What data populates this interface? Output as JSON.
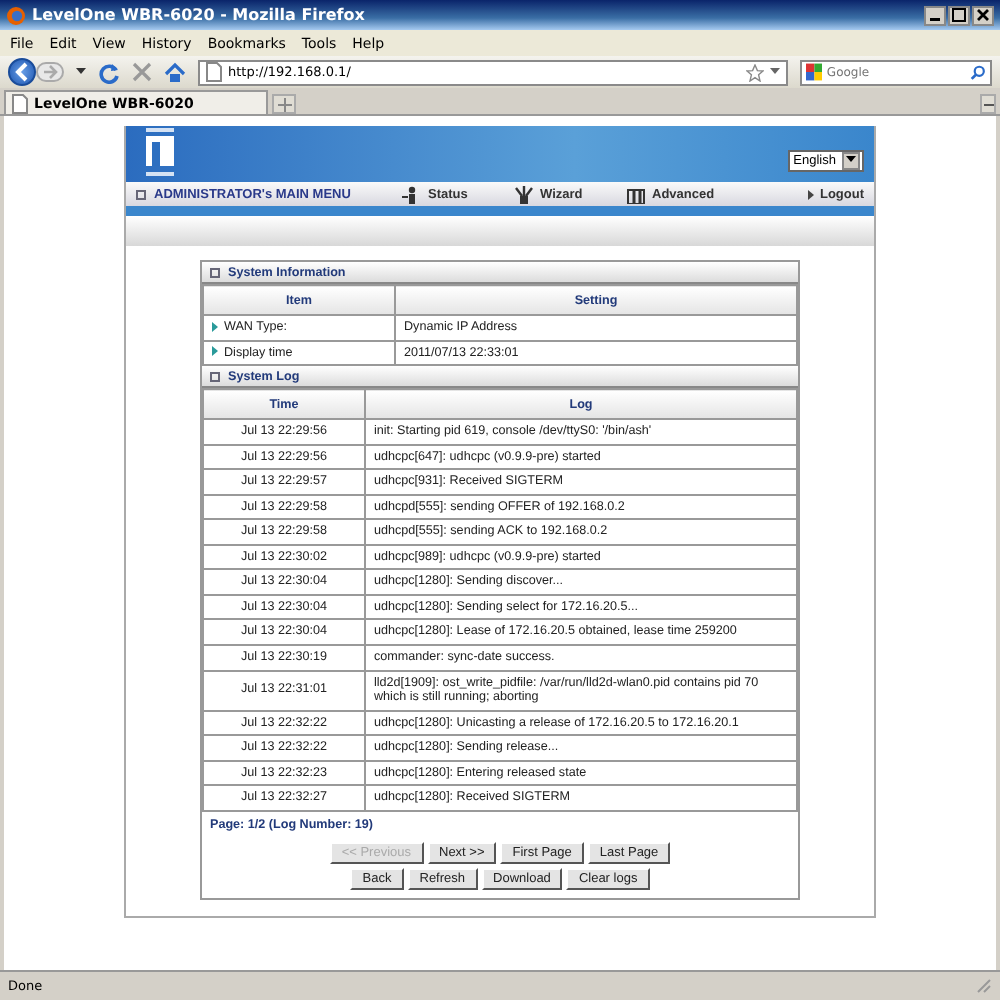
{
  "window": {
    "title": "LevelOne WBR-6020 - Mozilla Firefox"
  },
  "menu_bar": [
    "File",
    "Edit",
    "View",
    "History",
    "Bookmarks",
    "Tools",
    "Help"
  ],
  "address_bar": {
    "value": "http://192.168.0.1/"
  },
  "search": {
    "placeholder": "Google"
  },
  "tabs": [
    {
      "label": "LevelOne WBR-6020",
      "selected": true
    }
  ],
  "router_header": {
    "language": "English",
    "main_menu": "ADMINISTRATOR's MAIN MENU",
    "nav": [
      {
        "kind": "status",
        "label": "Status"
      },
      {
        "kind": "wizard",
        "label": "Wizard"
      },
      {
        "kind": "advanced",
        "label": "Advanced"
      }
    ],
    "logout": "Logout"
  },
  "system_information": {
    "title": "System Information",
    "columns": [
      "Item",
      "Setting"
    ],
    "rows": [
      {
        "item": "WAN Type:",
        "setting": "Dynamic IP Address"
      },
      {
        "item": "Display time",
        "setting": "2011/07/13 22:33:01"
      }
    ]
  },
  "system_log": {
    "title": "System Log",
    "columns": [
      "Time",
      "Log"
    ],
    "rows": [
      {
        "time": "Jul 13 22:29:56",
        "log": "init: Starting pid 619, console /dev/ttyS0: '/bin/ash'"
      },
      {
        "time": "Jul 13 22:29:56",
        "log": "udhcpc[647]: udhcpc (v0.9.9-pre) started"
      },
      {
        "time": "Jul 13 22:29:57",
        "log": "udhcpc[931]: Received SIGTERM"
      },
      {
        "time": "Jul 13 22:29:58",
        "log": "udhcpd[555]: sending OFFER of 192.168.0.2"
      },
      {
        "time": "Jul 13 22:29:58",
        "log": "udhcpd[555]: sending ACK to 192.168.0.2"
      },
      {
        "time": "Jul 13 22:30:02",
        "log": "udhcpc[989]: udhcpc (v0.9.9-pre) started"
      },
      {
        "time": "Jul 13 22:30:04",
        "log": "udhcpc[1280]: Sending discover..."
      },
      {
        "time": "Jul 13 22:30:04",
        "log": "udhcpc[1280]: Sending select for 172.16.20.5..."
      },
      {
        "time": "Jul 13 22:30:04",
        "log": "udhcpc[1280]: Lease of 172.16.20.5 obtained, lease time 259200"
      },
      {
        "time": "Jul 13 22:30:19",
        "log": "commander: sync-date success."
      },
      {
        "time": "Jul 13 22:31:01",
        "log": "lld2d[1909]: ost_write_pidfile: /var/run/lld2d-wlan0.pid contains pid 70 which is still running; aborting"
      },
      {
        "time": "Jul 13 22:32:22",
        "log": "udhcpc[1280]: Unicasting a release of 172.16.20.5 to 172.16.20.1"
      },
      {
        "time": "Jul 13 22:32:22",
        "log": "udhcpc[1280]: Sending release..."
      },
      {
        "time": "Jul 13 22:32:23",
        "log": "udhcpc[1280]: Entering released state"
      },
      {
        "time": "Jul 13 22:32:27",
        "log": "udhcpc[1280]: Received SIGTERM"
      }
    ],
    "page_info": "Page: 1/2 (Log Number: 19)",
    "pager_buttons": [
      {
        "label": "<< Previous",
        "disabled": true
      },
      {
        "label": "Next >>",
        "disabled": false
      },
      {
        "label": "First Page",
        "disabled": false
      },
      {
        "label": "Last Page",
        "disabled": false
      }
    ],
    "action_buttons": [
      {
        "label": "Back",
        "disabled": false
      },
      {
        "label": "Refresh",
        "disabled": false
      },
      {
        "label": "Download",
        "disabled": false
      },
      {
        "label": "Clear logs",
        "disabled": false
      }
    ]
  },
  "status_bar": {
    "text": "Done"
  }
}
